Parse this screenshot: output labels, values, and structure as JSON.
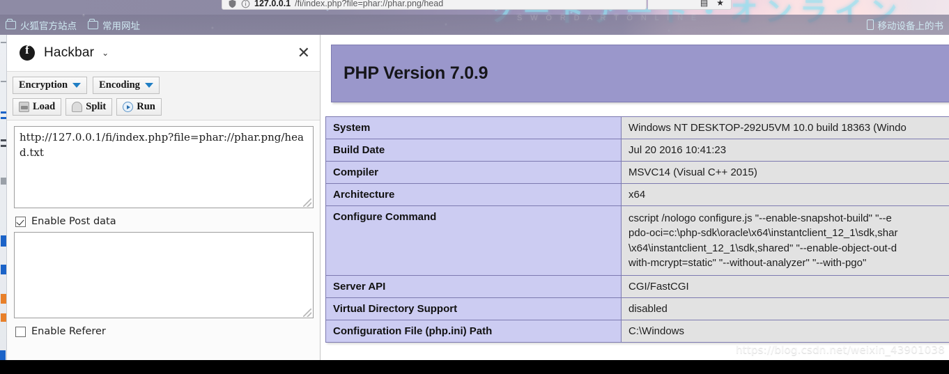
{
  "browser": {
    "url_bar": {
      "host": "127.0.0.1",
      "path": "/fi/index.php?file=phar://phar.png/head",
      "shield_icon": "shield-icon",
      "info_icon": "info-icon",
      "star_icon": "star-icon",
      "library_icon": "library-icon"
    },
    "bookmarks": [
      {
        "label": "火狐官方站点",
        "icon": "folder-icon"
      },
      {
        "label": "常用网址",
        "icon": "folder-icon"
      }
    ],
    "bookmarks_right": {
      "label": "移动设备上的书",
      "icon": "mobile-device-icon"
    }
  },
  "banner": {
    "kana": "ソードアート・オンライン",
    "subtitle": "S W O R D   A R T   O N L I N E"
  },
  "hackbar": {
    "title": "Hackbar",
    "logo_icon": "hackbar-logo-icon",
    "chevron_icon": "chevron-down-icon",
    "close_icon": "close-icon",
    "toolbar": {
      "encryption": "Encryption",
      "encoding": "Encoding",
      "load": "Load",
      "split": "Split",
      "run": "Run"
    },
    "url_value": "http://127.0.0.1/fi/index.php?file=phar://phar.png/head.txt",
    "post_value": "",
    "enable_post_data": {
      "label": "Enable Post data",
      "checked": true
    },
    "enable_referer": {
      "label": "Enable Referer",
      "checked": false
    }
  },
  "phpinfo": {
    "heading": "PHP Version 7.0.9",
    "rows": [
      {
        "key": "System",
        "value": "Windows NT DESKTOP-292U5VM 10.0 build 18363 (Windo"
      },
      {
        "key": "Build Date",
        "value": "Jul 20 2016 10:41:23"
      },
      {
        "key": "Compiler",
        "value": "MSVC14 (Visual C++ 2015)"
      },
      {
        "key": "Architecture",
        "value": "x64"
      },
      {
        "key": "Configure Command",
        "value": "",
        "lines": [
          "cscript /nologo configure.js \"--enable-snapshot-build\" \"--e",
          "pdo-oci=c:\\php-sdk\\oracle\\x64\\instantclient_12_1\\sdk,shar",
          "\\x64\\instantclient_12_1\\sdk,shared\" \"--enable-object-out-d",
          "with-mcrypt=static\" \"--without-analyzer\" \"--with-pgo\""
        ]
      },
      {
        "key": "Server API",
        "value": "CGI/FastCGI"
      },
      {
        "key": "Virtual Directory Support",
        "value": "disabled"
      },
      {
        "key": "Configuration File (php.ini) Path",
        "value": "C:\\Windows"
      }
    ]
  },
  "watermark": "https://blog.csdn.net/weixin_43901038",
  "colors": {
    "php_header_bg": "#9a97cb",
    "table_key_bg": "#ccccf2",
    "table_value_bg": "#e2e2e2",
    "table_border": "#7d7ab0",
    "accent_caret": "#1f7ec4"
  }
}
